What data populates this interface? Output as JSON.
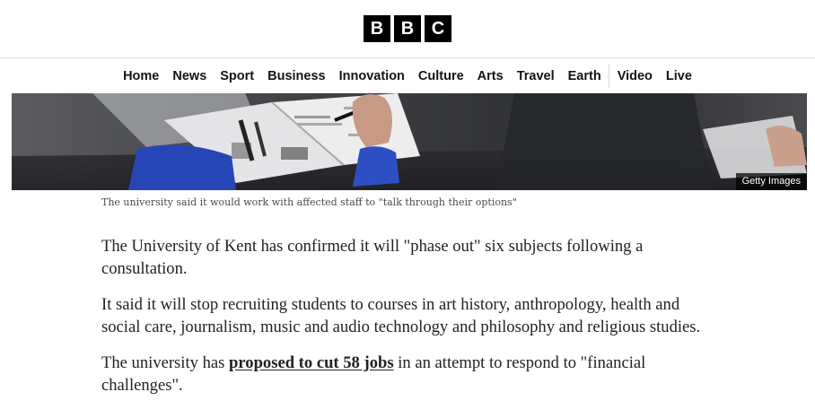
{
  "header": {
    "logo": [
      "B",
      "B",
      "C"
    ]
  },
  "nav": {
    "items": [
      "Home",
      "News",
      "Sport",
      "Business",
      "Innovation",
      "Culture",
      "Arts",
      "Travel",
      "Earth"
    ],
    "items_after_divider": [
      "Video",
      "Live"
    ]
  },
  "hero": {
    "credit": "Getty Images"
  },
  "caption": "The university said it would work with affected staff to \"talk through their options\"",
  "article": {
    "p1": "The University of Kent has confirmed it will \"phase out\" six subjects following a consultation.",
    "p2": "It said it will stop recruiting students to courses in art history, anthropology, health and social care, journalism, music and audio technology and philosophy and religious studies.",
    "p3_before": "The university has ",
    "p3_link": "proposed to cut 58 jobs",
    "p3_after": " in an attempt to respond to \"financial challenges\"."
  }
}
